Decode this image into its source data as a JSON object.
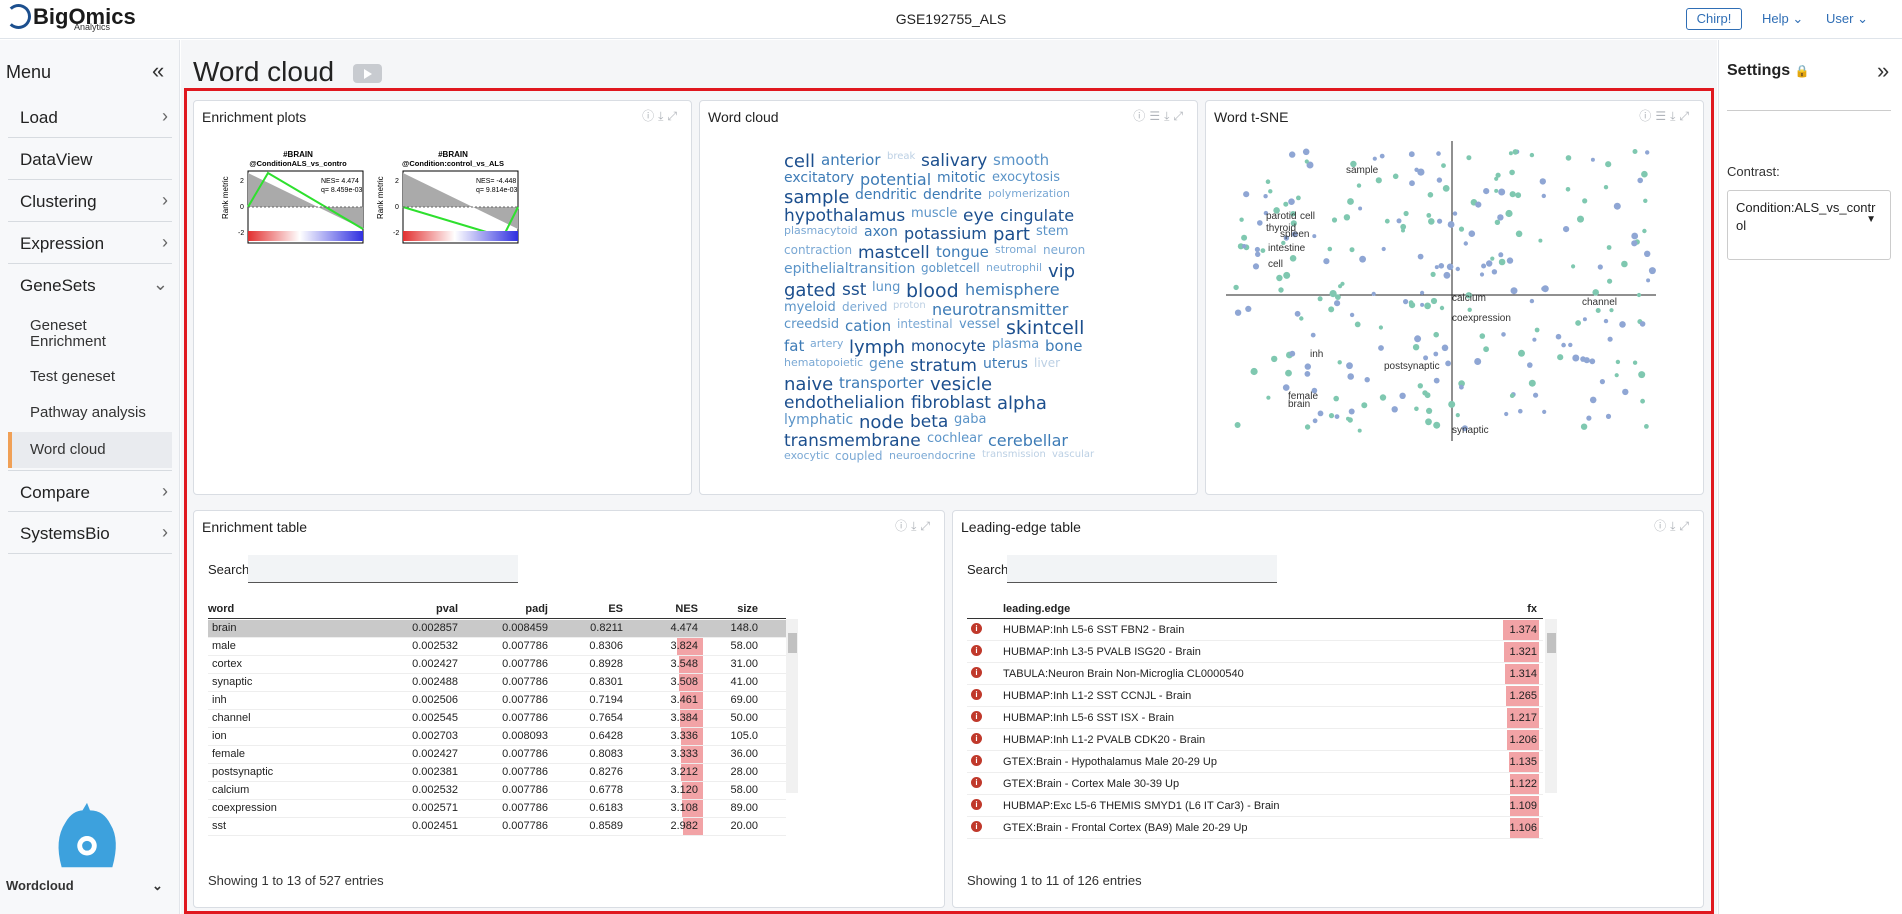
{
  "header": {
    "logo_text": "BigOmics",
    "logo_sub": "Analytics",
    "dataset": "GSE192755_ALS",
    "chirp": "Chirp!",
    "help": "Help",
    "user": "User"
  },
  "sidebar": {
    "menu_title": "Menu",
    "items": [
      {
        "label": "Load"
      },
      {
        "label": "DataView"
      },
      {
        "label": "Clustering"
      },
      {
        "label": "Expression"
      },
      {
        "label": "GeneSets"
      },
      {
        "label": "Compare"
      },
      {
        "label": "SystemsBio"
      }
    ],
    "subitems": [
      {
        "label": "Geneset Enrichment"
      },
      {
        "label": "Test geneset"
      },
      {
        "label": "Pathway analysis"
      },
      {
        "label": "Word cloud"
      }
    ],
    "bottom_label": "Wordcloud"
  },
  "page": {
    "title": "Word cloud"
  },
  "cards": {
    "enrichment_plots": {
      "title": "Enrichment plots",
      "plot1": {
        "title": "#BRAIN",
        "subtitle": "@ConditionALS_vs_contro",
        "nes": "NES= 4.474",
        "q": "q= 8.459e-03",
        "ylab": "Rank metric"
      },
      "plot2": {
        "title": "#BRAIN",
        "subtitle": "@Condition:control_vs_ALS",
        "nes": "NES= -4.448",
        "q": "q= 9.814e-03",
        "ylab": "Rank metric"
      }
    },
    "word_cloud": {
      "title": "Word cloud"
    },
    "word_tsne": {
      "title": "Word t-SNE",
      "labels": [
        "sample",
        "parotid",
        "cell",
        "thyroid",
        "spleen",
        "intestine",
        "cell",
        "calcium",
        "channel",
        "coexpression",
        "inh",
        "postsynaptic",
        "female",
        "brain",
        "synaptic"
      ]
    },
    "enrichment_table": {
      "title": "Enrichment table"
    },
    "leading_edge": {
      "title": "Leading-edge table"
    }
  },
  "word_cloud_words": [
    {
      "w": "cell",
      "c": "#1c4f8e"
    },
    {
      "w": "anterior",
      "c": "#3d7bb6"
    },
    {
      "w": "break",
      "c": "#bcd0e4"
    },
    {
      "w": "salivary",
      "c": "#1c4f8e"
    },
    {
      "w": "smooth",
      "c": "#5b94c8"
    },
    {
      "w": "excitatory",
      "c": "#3d7bb6"
    },
    {
      "w": "potential",
      "c": "#3d7bb6"
    },
    {
      "w": "mitotic",
      "c": "#3d7bb6"
    },
    {
      "w": "exocytosis",
      "c": "#5b94c8"
    },
    {
      "w": "sample",
      "c": "#1c4f8e"
    },
    {
      "w": "dendritic",
      "c": "#3d7bb6"
    },
    {
      "w": "dendrite",
      "c": "#3d7bb6"
    },
    {
      "w": "polymerization",
      "c": "#7aa8d4"
    },
    {
      "w": "hypothalamus",
      "c": "#1c4f8e"
    },
    {
      "w": "muscle",
      "c": "#5b94c8"
    },
    {
      "w": "eye",
      "c": "#1c4f8e"
    },
    {
      "w": "cingulate",
      "c": "#1c4f8e"
    },
    {
      "w": "plasmacytoid",
      "c": "#7aa8d4"
    },
    {
      "w": "axon",
      "c": "#3d7bb6"
    },
    {
      "w": "potassium",
      "c": "#1c4f8e"
    },
    {
      "w": "part",
      "c": "#1c4f8e"
    },
    {
      "w": "stem",
      "c": "#5b94c8"
    },
    {
      "w": "contraction",
      "c": "#7aa8d4"
    },
    {
      "w": "mastcell",
      "c": "#1c4f8e"
    },
    {
      "w": "tongue",
      "c": "#3d7bb6"
    },
    {
      "w": "stromal",
      "c": "#7aa8d4"
    },
    {
      "w": "neuron",
      "c": "#7aa8d4"
    },
    {
      "w": "epithelialtransition",
      "c": "#5b94c8"
    },
    {
      "w": "gobletcell",
      "c": "#5b94c8"
    },
    {
      "w": "neutrophil",
      "c": "#7aa8d4"
    },
    {
      "w": "vip",
      "c": "#1c4f8e"
    },
    {
      "w": "gated",
      "c": "#1c4f8e"
    },
    {
      "w": "sst",
      "c": "#1c4f8e"
    },
    {
      "w": "lung",
      "c": "#5b94c8"
    },
    {
      "w": "blood",
      "c": "#1c4f8e"
    },
    {
      "w": "hemisphere",
      "c": "#3d7bb6"
    },
    {
      "w": "myeloid",
      "c": "#5b94c8"
    },
    {
      "w": "derived",
      "c": "#7aa8d4"
    },
    {
      "w": "proton",
      "c": "#bcd0e4"
    },
    {
      "w": "neurotransmitter",
      "c": "#3d7bb6"
    },
    {
      "w": "creedsid",
      "c": "#5b94c8"
    },
    {
      "w": "cation",
      "c": "#3d7bb6"
    },
    {
      "w": "intestinal",
      "c": "#7aa8d4"
    },
    {
      "w": "vessel",
      "c": "#5b94c8"
    },
    {
      "w": "skintcell",
      "c": "#1c4f8e"
    },
    {
      "w": "fat",
      "c": "#3d7bb6"
    },
    {
      "w": "artery",
      "c": "#7aa8d4"
    },
    {
      "w": "lymph",
      "c": "#1c4f8e"
    },
    {
      "w": "monocyte",
      "c": "#1c4f8e"
    },
    {
      "w": "plasma",
      "c": "#5b94c8"
    },
    {
      "w": "bone",
      "c": "#3d7bb6"
    },
    {
      "w": "hematopoietic",
      "c": "#7aa8d4"
    },
    {
      "w": "gene",
      "c": "#5b94c8"
    },
    {
      "w": "stratum",
      "c": "#1c4f8e"
    },
    {
      "w": "uterus",
      "c": "#3d7bb6"
    },
    {
      "w": "liver",
      "c": "#bcd0e4"
    },
    {
      "w": "naive",
      "c": "#1c4f8e"
    },
    {
      "w": "transporter",
      "c": "#3d7bb6"
    },
    {
      "w": "vesicle",
      "c": "#1c4f8e"
    },
    {
      "w": "endothelialion",
      "c": "#1c4f8e"
    },
    {
      "w": "fibroblast",
      "c": "#1c4f8e"
    },
    {
      "w": "alpha",
      "c": "#1c4f8e"
    },
    {
      "w": "lymphatic",
      "c": "#5b94c8"
    },
    {
      "w": "node",
      "c": "#1c4f8e"
    },
    {
      "w": "beta",
      "c": "#1c4f8e"
    },
    {
      "w": "gaba",
      "c": "#5b94c8"
    },
    {
      "w": "transmembrane",
      "c": "#1c4f8e"
    },
    {
      "w": "cochlear",
      "c": "#5b94c8"
    },
    {
      "w": "cerebellar",
      "c": "#3d7bb6"
    },
    {
      "w": "exocytic",
      "c": "#7aa8d4"
    },
    {
      "w": "coupled",
      "c": "#7aa8d4"
    },
    {
      "w": "neuroendocrine",
      "c": "#7aa8d4"
    },
    {
      "w": "transmission",
      "c": "#bcd0e4"
    },
    {
      "w": "vascular",
      "c": "#bcd0e4"
    }
  ],
  "enrichment_table": {
    "search_label": "Search:",
    "search_value": "",
    "columns": [
      "word",
      "pval",
      "padj",
      "ES",
      "NES",
      "size"
    ],
    "rows": [
      [
        "brain",
        "0.002857",
        "0.008459",
        "0.8211",
        "4.474",
        "148.0"
      ],
      [
        "male",
        "0.002532",
        "0.007786",
        "0.8306",
        "3.824",
        "58.00"
      ],
      [
        "cortex",
        "0.002427",
        "0.007786",
        "0.8928",
        "3.548",
        "31.00"
      ],
      [
        "synaptic",
        "0.002488",
        "0.007786",
        "0.8301",
        "3.508",
        "41.00"
      ],
      [
        "inh",
        "0.002506",
        "0.007786",
        "0.7194",
        "3.461",
        "69.00"
      ],
      [
        "channel",
        "0.002545",
        "0.007786",
        "0.7654",
        "3.384",
        "50.00"
      ],
      [
        "ion",
        "0.002703",
        "0.008093",
        "0.6428",
        "3.336",
        "105.0"
      ],
      [
        "female",
        "0.002427",
        "0.007786",
        "0.8083",
        "3.333",
        "36.00"
      ],
      [
        "postsynaptic",
        "0.002381",
        "0.007786",
        "0.8276",
        "3.212",
        "28.00"
      ],
      [
        "calcium",
        "0.002532",
        "0.007786",
        "0.6778",
        "3.120",
        "58.00"
      ],
      [
        "coexpression",
        "0.002571",
        "0.007786",
        "0.6183",
        "3.108",
        "89.00"
      ],
      [
        "sst",
        "0.002451",
        "0.007786",
        "0.8589",
        "2.982",
        "20.00"
      ]
    ],
    "footer": "Showing 1 to 13 of 527 entries"
  },
  "leading_edge_table": {
    "search_label": "Search:",
    "search_value": "",
    "columns": [
      "leading.edge",
      "fx"
    ],
    "rows": [
      [
        "HUBMAP:Inh L5-6 SST FBN2 - Brain",
        "1.374"
      ],
      [
        "HUBMAP:Inh L3-5 PVALB ISG20 - Brain",
        "1.321"
      ],
      [
        "TABULA:Neuron Brain Non-Microglia CL0000540",
        "1.314"
      ],
      [
        "HUBMAP:Inh L1-2 SST CCNJL - Brain",
        "1.265"
      ],
      [
        "HUBMAP:Inh L5-6 SST ISX - Brain",
        "1.217"
      ],
      [
        "HUBMAP:Inh L1-2 PVALB CDK20 - Brain",
        "1.206"
      ],
      [
        "GTEX:Brain - Hypothalamus Male 20-29 Up",
        "1.135"
      ],
      [
        "GTEX:Brain - Cortex Male 30-39 Up",
        "1.122"
      ],
      [
        "HUBMAP:Exc L5-6 THEMIS SMYD1 (L6 IT Car3) - Brain",
        "1.109"
      ],
      [
        "GTEX:Brain - Frontal Cortex (BA9) Male 20-29 Up",
        "1.106"
      ]
    ],
    "footer": "Showing 1 to 11 of 126 entries"
  },
  "settings": {
    "title": "Settings",
    "contrast_label": "Contrast:",
    "contrast_value": "Condition:ALS_vs_contr ol"
  },
  "colors": {
    "accent": "#2f6eb5",
    "red_frame": "#e0181f",
    "nes_bar": "#f2a3a6",
    "active_marker": "#f0a056"
  }
}
